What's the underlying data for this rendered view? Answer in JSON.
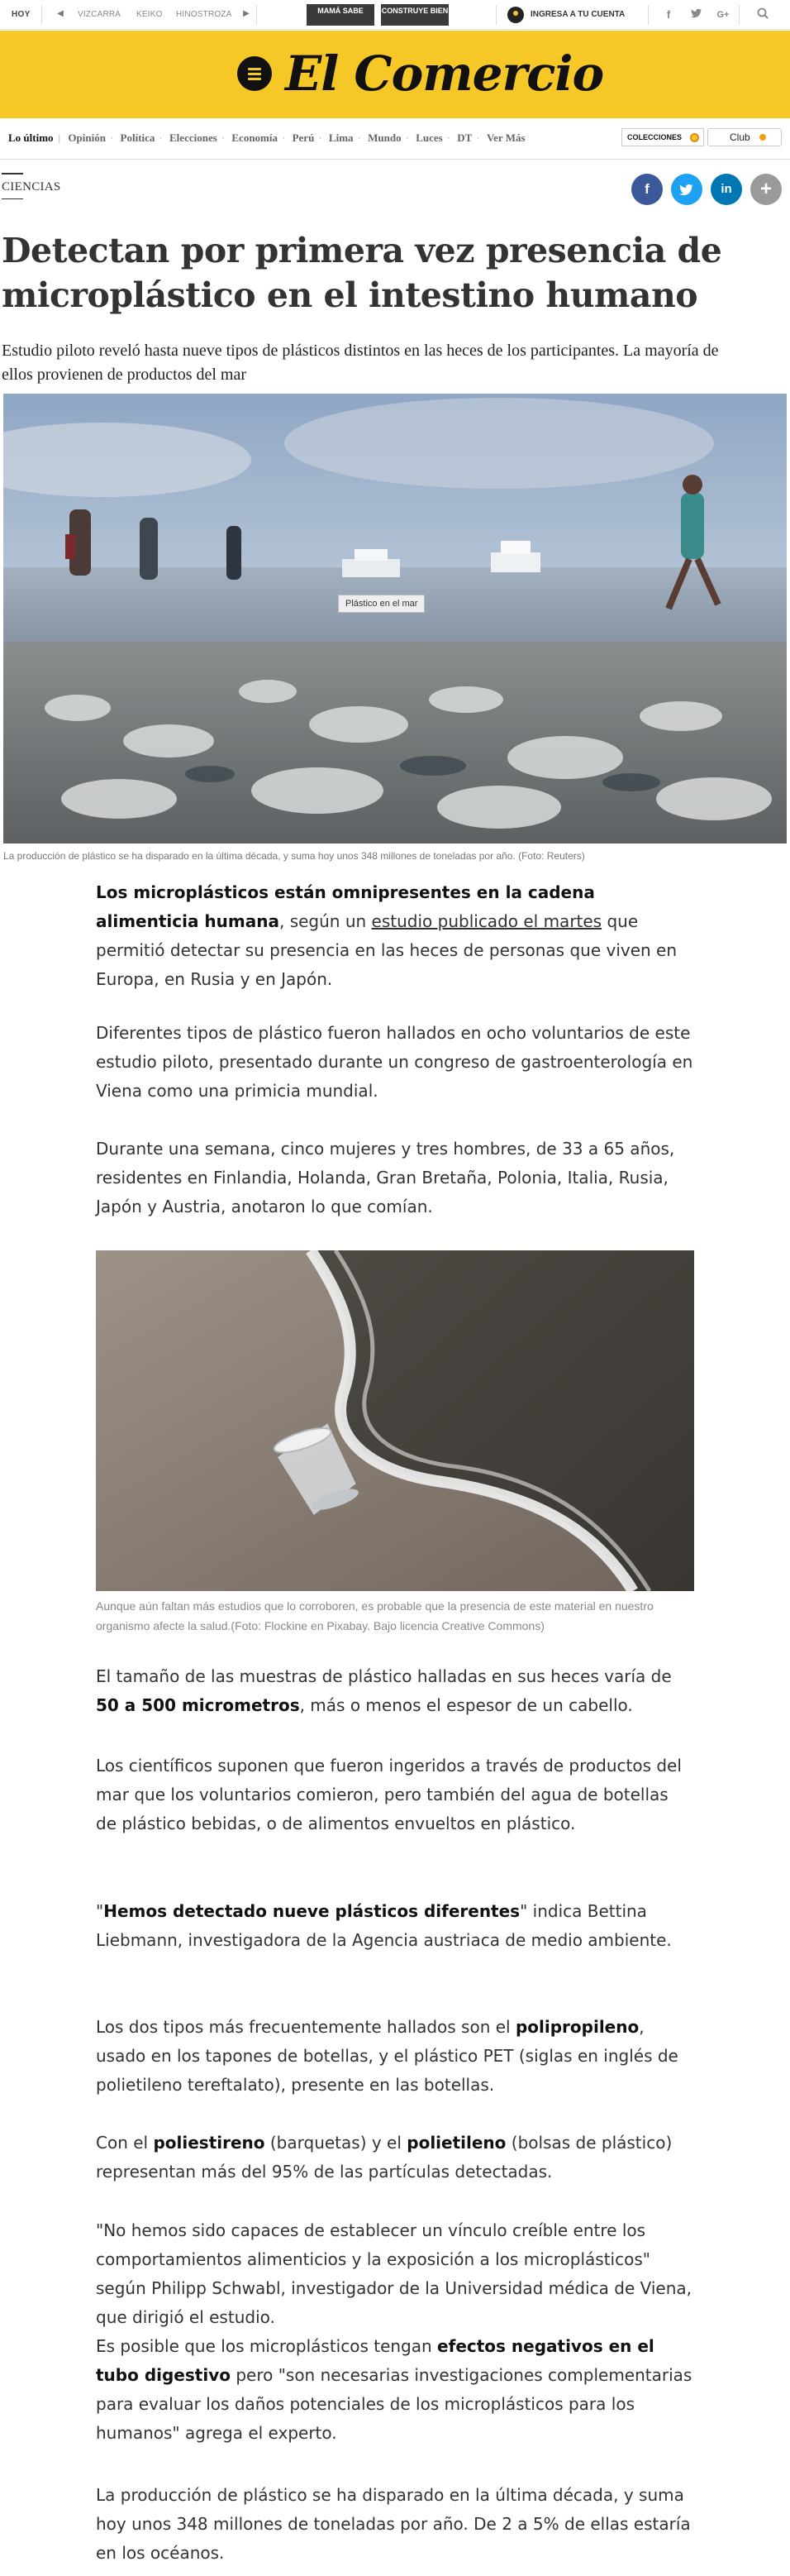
{
  "topbar": {
    "hoy": "HOY",
    "tags": [
      "VIZCARRA",
      "KEIKO",
      "HINOSTROZA"
    ],
    "pill_1": "MAMÁ SABE",
    "pill_2": "CONSTRUYE BIEN",
    "account": "INGRESA A TU CUENTA",
    "social_icons": [
      "facebook-icon",
      "twitter-icon",
      "google-plus-icon",
      "search-icon"
    ]
  },
  "masthead": {
    "logo": "El Comercio",
    "brand_color": "#f6c827"
  },
  "nav": {
    "first": "Lo último",
    "items": [
      "Opinión",
      "Política",
      "Elecciones",
      "Economía",
      "Perú",
      "Lima",
      "Mundo",
      "Luces",
      "DT",
      "Ver Más"
    ],
    "colecciones": "COLECCIONES",
    "club": "Club"
  },
  "article": {
    "section": "CIENCIAS",
    "headline": "Detectan por primera vez presencia de microplástico en el intestino humano",
    "subhead": "Estudio piloto reveló hasta nueve tipos de plásticos distintos en las heces de los participantes. La mayoría de ellos provienen de productos del mar",
    "hero_tooltip": "Plástico en el mar",
    "hero_caption": "La producción de plástico se ha disparado en la última década, y suma hoy unos 348 millones de toneladas por año. (Foto: Reuters)",
    "p1": {
      "bold": "Los microplásticos están omnipresentes en la cadena alimenticia humana",
      "pre_link": ", según un ",
      "link": "estudio publicado el martes",
      "post_link": " que permitió detectar su presencia en las heces de personas que viven en Europa, en Rusia y en Japón."
    },
    "p2": "Diferentes tipos de plástico fueron hallados en ocho voluntarios de este estudio piloto, presentado durante un congreso de gastroenterología en Viena como una primicia mundial.",
    "p3": "Durante una semana, cinco mujeres y tres hombres, de 33 a 65 años, residentes en Finlandia, Holanda, Gran Bretaña, Polonia, Italia, Rusia, Japón y Austria, anotaron lo que comían.",
    "photo_caption": "Aunque aún faltan más estudios que lo corroboren, es probable que la presencia de este material en nuestro organismo afecte la salud.(Foto: Flockine en Pixabay. Bajo licencia Creative Commons)",
    "p4": {
      "pre": "El tamaño de las muestras de plástico halladas en sus heces varía de ",
      "bold": "50 a 500 micrometros",
      "post": ", más o menos el espesor de un cabello."
    },
    "p5": "Los científicos suponen que fueron ingeridos a través de productos del mar que los voluntarios comieron, pero también del agua de botellas de plástico bebidas, o de alimentos envueltos en plástico.",
    "p6": {
      "open": "\"",
      "bold": "Hemos detectado nueve plásticos diferentes",
      "post": "\" indica Bettina Liebmann, investigadora de la Agencia austriaca de medio ambiente."
    },
    "p7": {
      "pre": "Los dos tipos más frecuentemente hallados son el ",
      "bold": "polipropileno",
      "post": ", usado en los tapones de botellas, y el plástico PET (siglas en inglés de polietileno tereftalato), presente en las botellas."
    },
    "p8": {
      "pre": "Con el ",
      "bold1": "poliestireno",
      "mid": " (barquetas) y el ",
      "bold2": "polietileno",
      "post": " (bolsas de plástico) representan más del 95% de las partículas detectadas."
    },
    "p9": "\"No hemos sido capaces de establecer un vínculo creíble entre los comportamientos alimenticios y la exposición a los microplásticos\" según Philipp Schwabl, investigador de la Universidad médica de Viena, que dirigió el estudio.",
    "p10": {
      "pre": "Es posible que los microplásticos tengan ",
      "bold": "efectos negativos en el tubo digestivo",
      "post": " pero \"son necesarias investigaciones complementarias para evaluar los daños potenciales de los microplásticos para los humanos\" agrega el experto."
    },
    "p11": "La producción de plástico se ha disparado en la última década, y suma hoy unos 348 millones de toneladas por año. De 2 a 5% de ellas estaría en los océanos."
  },
  "share": {
    "facebook": "f",
    "twitter": "t",
    "linkedin": "in",
    "more": "+",
    "colors": {
      "facebook": "#3b5998",
      "twitter": "#1da1f2",
      "linkedin": "#0077b5",
      "more": "#9a9a9a"
    }
  }
}
